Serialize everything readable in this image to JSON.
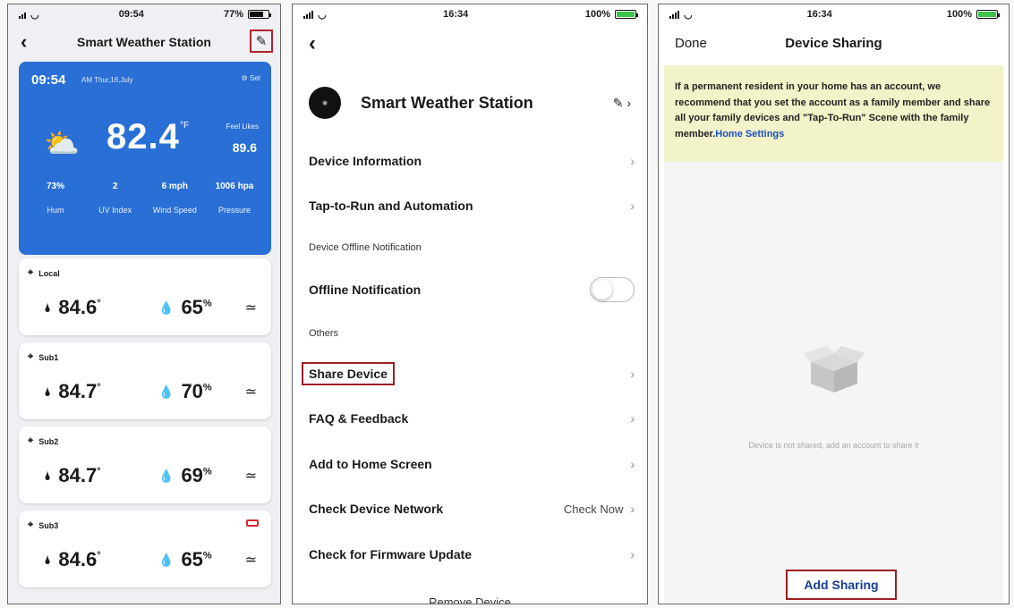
{
  "phone1": {
    "status": {
      "time": "09:54",
      "battery": "77%"
    },
    "title": "Smart Weather Station",
    "weather": {
      "time": "09:54",
      "date": "AM Thur,16,July",
      "settings": "Set",
      "temp": "82.4",
      "temp_unit": "°F",
      "feels_like_label": "Feel Likes",
      "feels_like": "89.6",
      "stats": [
        {
          "value": "73%",
          "label": "Hum"
        },
        {
          "value": "2",
          "label": "UV Index"
        },
        {
          "value": "6 mph",
          "label": "Wind Speed"
        },
        {
          "value": "1006 hpa",
          "label": "Pressure"
        }
      ]
    },
    "sensors": [
      {
        "name": "Local",
        "temp": "84.6",
        "hum": "65"
      },
      {
        "name": "Sub1",
        "temp": "84.7",
        "hum": "70"
      },
      {
        "name": "Sub2",
        "temp": "84.7",
        "hum": "69"
      },
      {
        "name": "Sub3",
        "temp": "84.6",
        "hum": "65",
        "low_battery": true
      }
    ]
  },
  "phone2": {
    "status": {
      "time": "16:34",
      "battery": "100%"
    },
    "device_name": "Smart Weather Station",
    "rows": {
      "device_info": "Device Information",
      "tap_to_run": "Tap-to-Run and Automation",
      "offline_section": "Device Offline Notification",
      "offline_notification": "Offline Notification",
      "others_section": "Others",
      "share_device": "Share Device",
      "faq": "FAQ & Feedback",
      "add_home": "Add to Home Screen",
      "check_network": "Check Device Network",
      "check_now": "Check Now",
      "firmware": "Check for Firmware Update",
      "remove": "Remove Device"
    }
  },
  "phone3": {
    "status": {
      "time": "16:34",
      "battery": "100%"
    },
    "done": "Done",
    "title": "Device Sharing",
    "banner_text": "If a permanent resident in your home has an account, we recommend that you set the account as a family member and share all your family devices and \"Tap-To-Run\" Scene with the family member.",
    "banner_link": "Home Settings",
    "empty_text": "Device is not shared, add an account to share it",
    "add_sharing": "Add Sharing"
  },
  "colors": {
    "accent_blue": "#2a6fd6",
    "highlight_red": "#9b1e23",
    "banner_yellow": "#f2f3c9",
    "link_blue": "#1c4fc4"
  }
}
